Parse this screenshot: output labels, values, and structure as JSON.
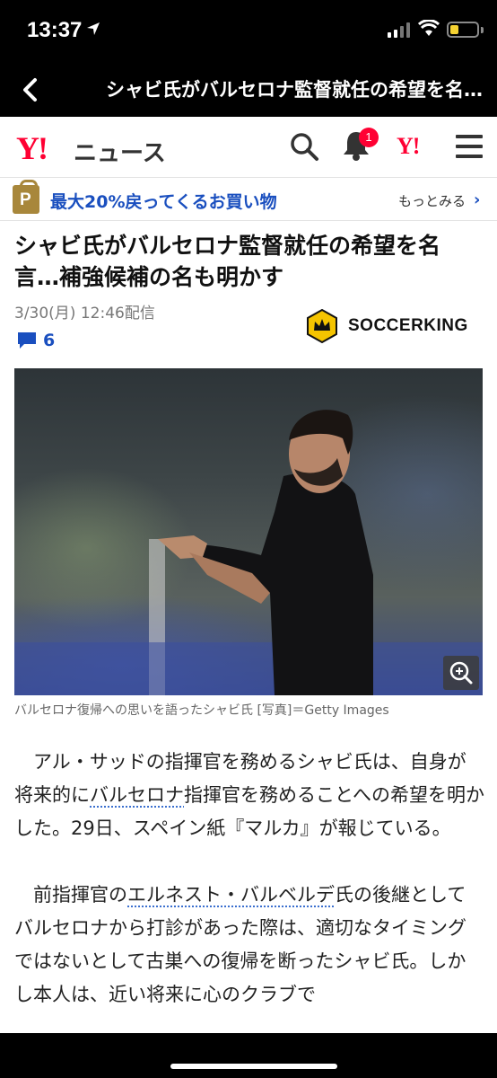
{
  "status_bar": {
    "time": "13:37"
  },
  "nav": {
    "title": "シャビ氏がバルセロナ監督就任の希望を名…"
  },
  "header": {
    "logo": "Y!",
    "logo_suffix": "ニュース",
    "notification_count": "1",
    "yahoo_link": "Y!"
  },
  "promo": {
    "text": "最大20%戻ってくるお買い物",
    "more": "もっとみる",
    "icon_letter": "P"
  },
  "article": {
    "headline": "シャビ氏がバルセロナ監督就任の希望を名言…補強候補の名も明かす",
    "date": "3/30(月) 12:46配信",
    "comment_count": "6",
    "source": "SOCCERKING",
    "photo_caption": "バルセロナ復帰への思いを語ったシャビ氏 [写真]＝Getty Images",
    "p1": [
      {
        "text": "アル・サッドの指揮官を務めるシャビ氏は、自身が将来的に",
        "link": false
      },
      {
        "text": "バルセロナ",
        "link": true
      },
      {
        "text": "指揮官を務めることへの希望を明かした。29日、スペイン紙『マルカ』が報じている。",
        "link": false
      }
    ],
    "p2": [
      {
        "text": "前指揮官の",
        "link": false
      },
      {
        "text": "エルネスト・バルベルデ",
        "link": true
      },
      {
        "text": "氏の後継としてバルセロナから打診があった際は、適切なタイミングではないとして古巣への復帰を断ったシャビ氏。しかし本人は、近い将来に心のクラブで",
        "link": false
      }
    ]
  },
  "colors": {
    "brand_red": "#ff0033",
    "link_blue": "#1a4fbf",
    "promo_gold": "#a8873b"
  }
}
